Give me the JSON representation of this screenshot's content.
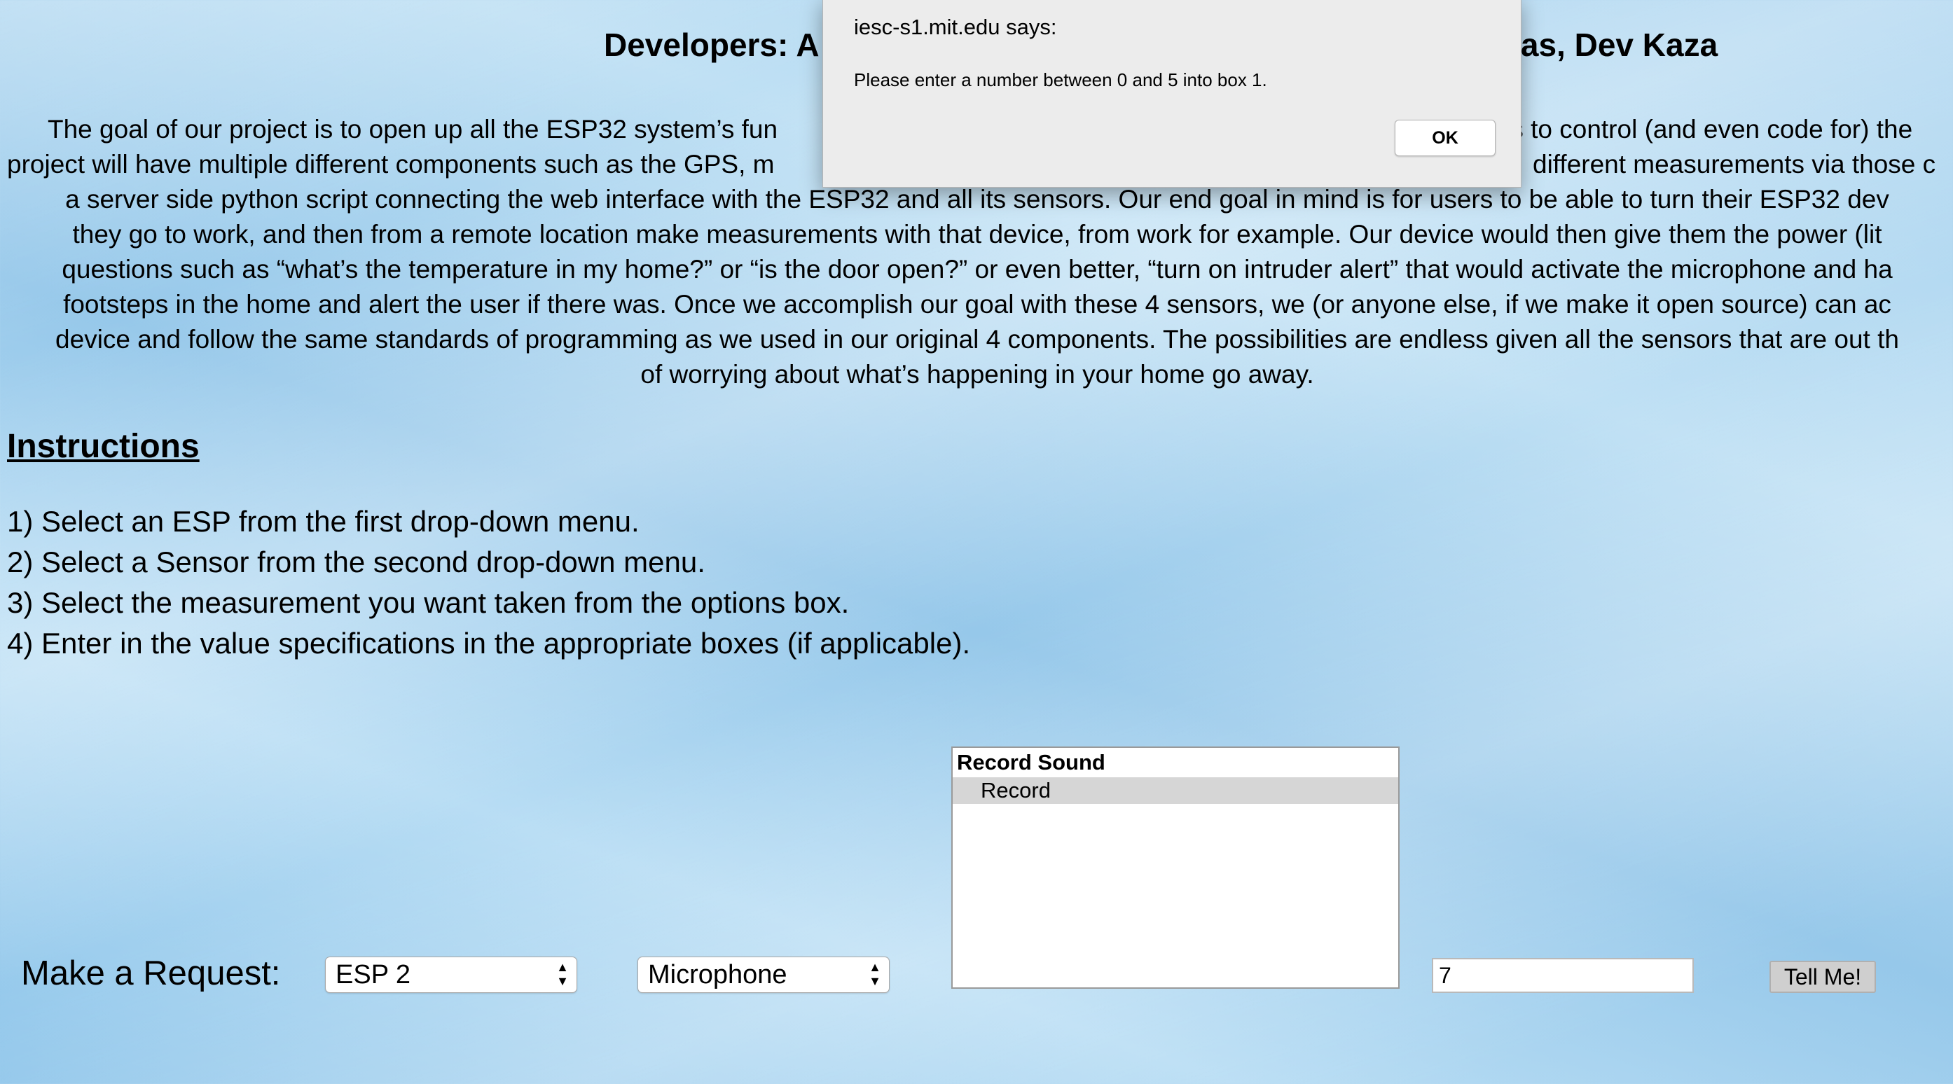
{
  "page": {
    "title_left": "Developers: A",
    "title_right": "olas, Dev Kaza",
    "intro_lines": [
      "The goal of our project is to open up all the ESP32 system’s fun",
      "project will have multiple different components such as the GPS, m",
      "a server side python script connecting the web interface with the ESP32 and all its sensors. Our end goal in mind is for users to be able to turn their ESP32 dev",
      "they go to work, and then from a remote location make measurements with that device, from work for example. Our device would then give them the power (lit",
      "questions such as “what’s the temperature in my home?” or “is the door open?” or even better, “turn on intruder alert” that would activate the microphone and ha",
      "footsteps in the home and alert the user if there was. Once we accomplish our goal with these 4 sensors, we (or anyone else, if we make it open source) can ac",
      "device and follow the same standards of programming as we used in our original 4 components. The possibilities are endless given all the sensors that are out th",
      "of worrying about what’s happening in your home go away."
    ],
    "intro_fragments_right": [
      "rs to control (and even code for) the",
      "different measurements via those c"
    ]
  },
  "instructions": {
    "heading": "Instructions",
    "steps": [
      "1) Select an ESP from the first drop-down menu.",
      "2) Select a Sensor from the second drop-down menu.",
      "3) Select the measurement you want taken from the options box.",
      "4) Enter in the value specifications in the appropriate boxes (if applicable)."
    ]
  },
  "request": {
    "label": "Make a Request:",
    "esp_select": "ESP 2",
    "sensor_select": "Microphone",
    "options_group": "Record Sound",
    "options_item": "Record",
    "value_input": "7",
    "submit_label": "Tell Me!"
  },
  "dialog": {
    "title": "iesc-s1.mit.edu says:",
    "message": "Please enter a number between 0 and 5 into box 1.",
    "ok_label": "OK"
  },
  "icons": {
    "select_arrows": "up-down-arrows-icon"
  }
}
